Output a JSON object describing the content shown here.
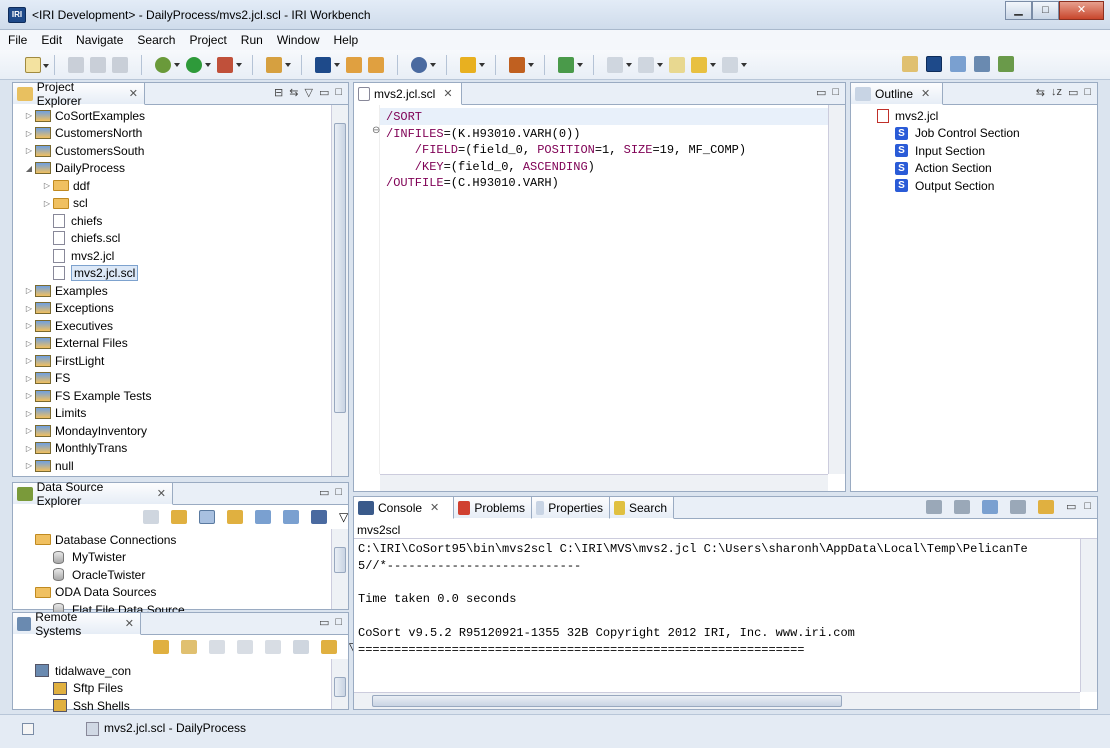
{
  "window": {
    "title": "<IRI Development> - DailyProcess/mvs2.jcl.scl - IRI Workbench",
    "app_icon_text": "IRI"
  },
  "menu": [
    "File",
    "Edit",
    "Navigate",
    "Search",
    "Project",
    "Run",
    "Window",
    "Help"
  ],
  "project_explorer": {
    "tab": "Project Explorer",
    "items": [
      {
        "label": "CoSortExamples",
        "level": 0,
        "type": "project",
        "expanded": false
      },
      {
        "label": "CustomersNorth",
        "level": 0,
        "type": "project",
        "expanded": false
      },
      {
        "label": "CustomersSouth",
        "level": 0,
        "type": "project",
        "expanded": false
      },
      {
        "label": "DailyProcess",
        "level": 0,
        "type": "project",
        "expanded": true
      },
      {
        "label": "ddf",
        "level": 1,
        "type": "folder",
        "expanded": false
      },
      {
        "label": "scl",
        "level": 1,
        "type": "folder",
        "expanded": false
      },
      {
        "label": "chiefs",
        "level": 1,
        "type": "file"
      },
      {
        "label": "chiefs.scl",
        "level": 1,
        "type": "file"
      },
      {
        "label": "mvs2.jcl",
        "level": 1,
        "type": "file"
      },
      {
        "label": "mvs2.jcl.scl",
        "level": 1,
        "type": "file",
        "selected": true
      },
      {
        "label": "Examples",
        "level": 0,
        "type": "project",
        "expanded": false
      },
      {
        "label": "Exceptions",
        "level": 0,
        "type": "project",
        "expanded": false
      },
      {
        "label": "Executives",
        "level": 0,
        "type": "project",
        "expanded": false
      },
      {
        "label": "External Files",
        "level": 0,
        "type": "project",
        "expanded": false
      },
      {
        "label": "FirstLight",
        "level": 0,
        "type": "project",
        "expanded": false
      },
      {
        "label": "FS",
        "level": 0,
        "type": "project",
        "expanded": false
      },
      {
        "label": "FS Example Tests",
        "level": 0,
        "type": "project",
        "expanded": false
      },
      {
        "label": "Limits",
        "level": 0,
        "type": "project",
        "expanded": false
      },
      {
        "label": "MondayInventory",
        "level": 0,
        "type": "project",
        "expanded": false
      },
      {
        "label": "MonthlyTrans",
        "level": 0,
        "type": "project",
        "expanded": false
      },
      {
        "label": "null",
        "level": 0,
        "type": "project",
        "expanded": false
      }
    ]
  },
  "data_source_explorer": {
    "tab": "Data Source Explorer",
    "items": [
      {
        "label": "Database Connections",
        "level": 0,
        "type": "folder"
      },
      {
        "label": "MyTwister",
        "level": 1,
        "type": "db"
      },
      {
        "label": "OracleTwister",
        "level": 1,
        "type": "db"
      },
      {
        "label": "ODA Data Sources",
        "level": 0,
        "type": "folder"
      },
      {
        "label": "Flat File Data Source",
        "level": 1,
        "type": "db"
      }
    ]
  },
  "remote_systems": {
    "tab": "Remote Systems",
    "items": [
      {
        "label": "tidalwave_con",
        "level": 0
      },
      {
        "label": "Sftp Files",
        "level": 1
      },
      {
        "label": "Ssh Shells",
        "level": 1
      }
    ]
  },
  "editor": {
    "tab": "mvs2.jcl.scl",
    "lines": [
      [
        {
          "t": "/SORT",
          "k": true
        }
      ],
      [
        {
          "t": "/INFILES",
          "k": true
        },
        {
          "t": "=(K.H93010.VARH(0))",
          "k": false
        }
      ],
      [
        {
          "t": "    /FIELD",
          "k": true
        },
        {
          "t": "=(field_0, ",
          "k": false
        },
        {
          "t": "POSITION",
          "k": true
        },
        {
          "t": "=1, ",
          "k": false
        },
        {
          "t": "SIZE",
          "k": true
        },
        {
          "t": "=19, MF_COMP)",
          "k": false
        }
      ],
      [
        {
          "t": "    /KEY",
          "k": true
        },
        {
          "t": "=(field_0, ",
          "k": false
        },
        {
          "t": "ASCENDING",
          "k": true
        },
        {
          "t": ")",
          "k": false
        }
      ],
      [
        {
          "t": "/OUTFILE",
          "k": true
        },
        {
          "t": "=(C.H93010.VARH)",
          "k": false
        }
      ]
    ]
  },
  "outline": {
    "tab": "Outline",
    "root": "mvs2.jcl",
    "items": [
      "Job Control Section",
      "Input Section",
      "Action Section",
      "Output Section"
    ],
    "icon_letter": "S"
  },
  "bottom_tabs": {
    "console": "Console",
    "problems": "Problems",
    "properties": "Properties",
    "search": "Search"
  },
  "console": {
    "name": "mvs2scl",
    "lines": [
      "C:\\IRI\\CoSort95\\bin\\mvs2scl C:\\IRI\\MVS\\mvs2.jcl C:\\Users\\sharonh\\AppData\\Local\\Temp\\PelicanTe",
      "5//*---------------------------",
      "",
      "Time taken 0.0 seconds",
      "",
      "CoSort v9.5.2 R95120921-1355 32B Copyright 2012 IRI, Inc. www.iri.com",
      "=============================================================="
    ]
  },
  "status": {
    "text": "mvs2.jcl.scl - DailyProcess"
  },
  "colors": {
    "keyword": "#7f0055",
    "selection": "#dce8f7",
    "chrome": "#dbe4ef"
  }
}
